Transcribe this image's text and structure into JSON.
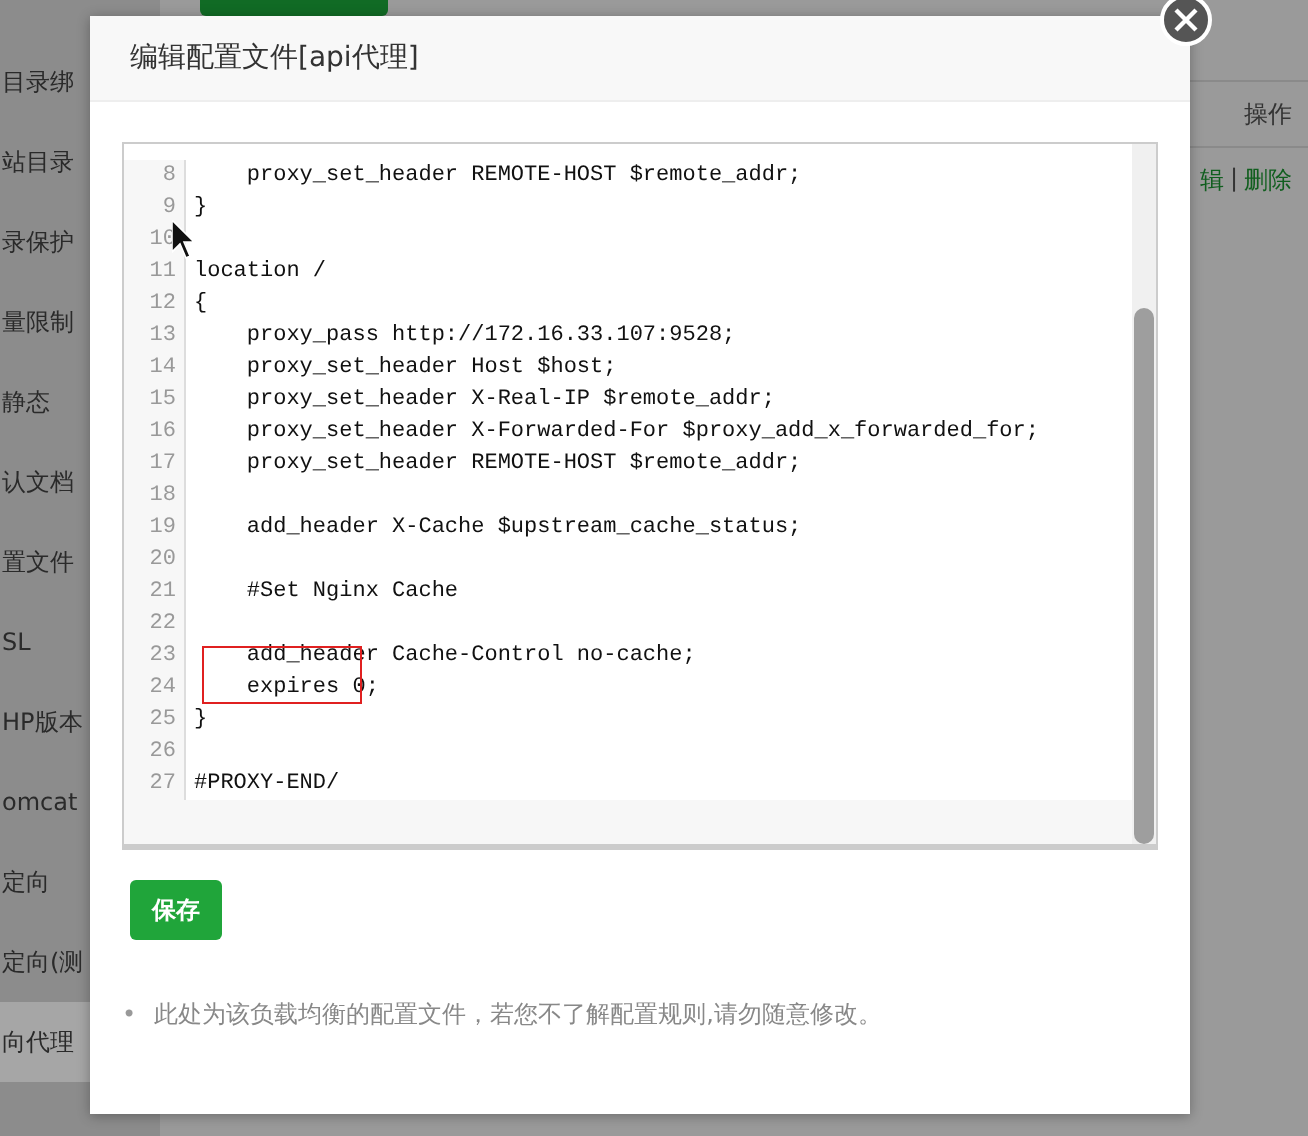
{
  "sidebar": {
    "items": [
      {
        "label": "目录绑",
        "selected": false
      },
      {
        "label": "站目录",
        "selected": false
      },
      {
        "label": "录保护",
        "selected": false
      },
      {
        "label": "量限制",
        "selected": false
      },
      {
        "label": "静态",
        "selected": false
      },
      {
        "label": "认文档",
        "selected": false
      },
      {
        "label": "置文件",
        "selected": false
      },
      {
        "label": "SL",
        "selected": false
      },
      {
        "label": "HP版本",
        "selected": false
      },
      {
        "label": "omcat",
        "selected": false
      },
      {
        "label": "定向",
        "selected": false
      },
      {
        "label": "定向(测",
        "selected": false
      },
      {
        "label": "向代理",
        "selected": true
      }
    ]
  },
  "table": {
    "header": "操作",
    "actions": [
      "辑",
      "删除"
    ],
    "separator": "|"
  },
  "dialog": {
    "title": "编辑配置文件[api代理]",
    "editor": {
      "lines": [
        {
          "number": "8",
          "text": "    proxy_set_header REMOTE-HOST $remote_addr;"
        },
        {
          "number": "9",
          "text": "}"
        },
        {
          "number": "10"
        },
        {
          "number": "11",
          "text": "location /"
        },
        {
          "number": "12",
          "text": "{"
        },
        {
          "number": "13",
          "text": "    proxy_pass http://172.16.33.107:9528;"
        },
        {
          "number": "14",
          "text": "    proxy_set_header Host $host;"
        },
        {
          "number": "15",
          "text": "    proxy_set_header X-Real-IP $remote_addr;"
        },
        {
          "number": "16",
          "text": "    proxy_set_header X-Forwarded-For $proxy_add_x_forwarded_for;"
        },
        {
          "number": "17",
          "text": "    proxy_set_header REMOTE-HOST $remote_addr;"
        },
        {
          "number": "18"
        },
        {
          "number": "19",
          "text": "    add_header X-Cache $upstream_cache_status;"
        },
        {
          "number": "20"
        },
        {
          "number": "21",
          "text": "    #Set Nginx Cache"
        },
        {
          "number": "22"
        },
        {
          "number": "23",
          "text": "    add_header Cache-Control no-cache;"
        },
        {
          "number": "24",
          "text": "    expires 0;",
          "boxed": true
        },
        {
          "number": "25",
          "text": "}"
        },
        {
          "number": "26"
        },
        {
          "number": "27",
          "text": "#PROXY-END/"
        }
      ]
    },
    "save_button": "保存",
    "notes": [
      {
        "bullet": "•",
        "text": "此处为该负载均衡的配置文件，若您不了解配置规则,请勿随意修改。"
      }
    ]
  }
}
